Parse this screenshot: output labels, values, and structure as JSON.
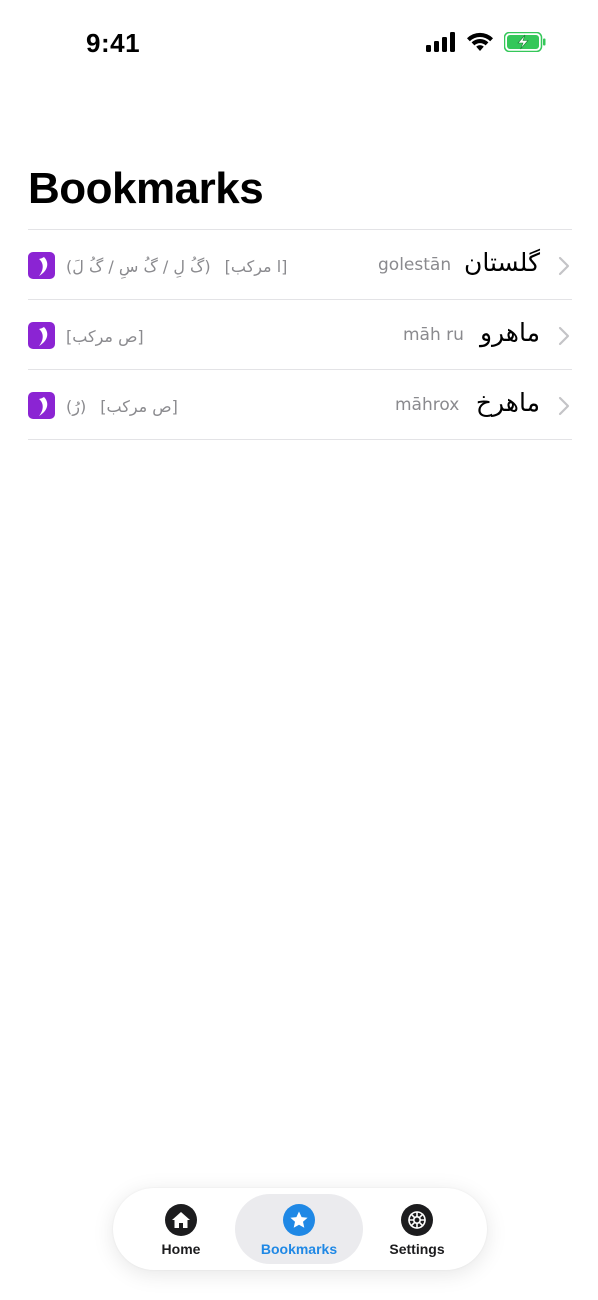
{
  "status_bar": {
    "time": "9:41",
    "icons": [
      "cellular-signal-icon",
      "wifi-icon",
      "battery-charging-icon"
    ],
    "battery_color": "#34c759"
  },
  "page": {
    "title": "Bookmarks"
  },
  "bookmarks": [
    {
      "word": "گلستان",
      "transliteration": "golestān",
      "grammar": [
        "[ا مرکب]",
        "(گُ لِ / گُ سِ / گُ لَ)"
      ],
      "badge_icon": "dictionary-badge-icon"
    },
    {
      "word": "ماهرو",
      "transliteration": "māh ru",
      "grammar": [
        "[ص مرکب]"
      ],
      "badge_icon": "dictionary-badge-icon"
    },
    {
      "word": "ماهرخ",
      "transliteration": "māhrox",
      "grammar": [
        "[ص مرکب]",
        "(رُ)"
      ],
      "badge_icon": "dictionary-badge-icon"
    }
  ],
  "tab_bar": {
    "tabs": [
      {
        "label": "Home",
        "icon": "home-icon"
      },
      {
        "label": "Bookmarks",
        "icon": "star-icon",
        "selected": true
      },
      {
        "label": "Settings",
        "icon": "gear-icon"
      }
    ]
  },
  "colors": {
    "accent": "#1f88e5",
    "badge": "#8b24d3",
    "secondary_text": "#8a8a8e"
  }
}
